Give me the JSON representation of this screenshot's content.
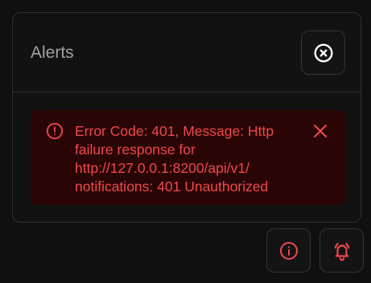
{
  "panel": {
    "title": "Alerts",
    "close_icon": "circle-x-icon"
  },
  "alert": {
    "message": "Error Code: 401, Message: Http failure response for http://127.0.0.1:8200/api/v1/ notifications: 401 Unauthorized",
    "status_icon": "alert-circle-icon",
    "dismiss_icon": "x-icon"
  },
  "footer": {
    "info_icon": "info-icon",
    "bell_icon": "bell-ringing-icon"
  },
  "colors": {
    "error_text": "#f0484a",
    "error_bg": "#2a0506",
    "panel_bg": "#121213",
    "border": "#303033",
    "title_text": "#a1a1a6"
  }
}
